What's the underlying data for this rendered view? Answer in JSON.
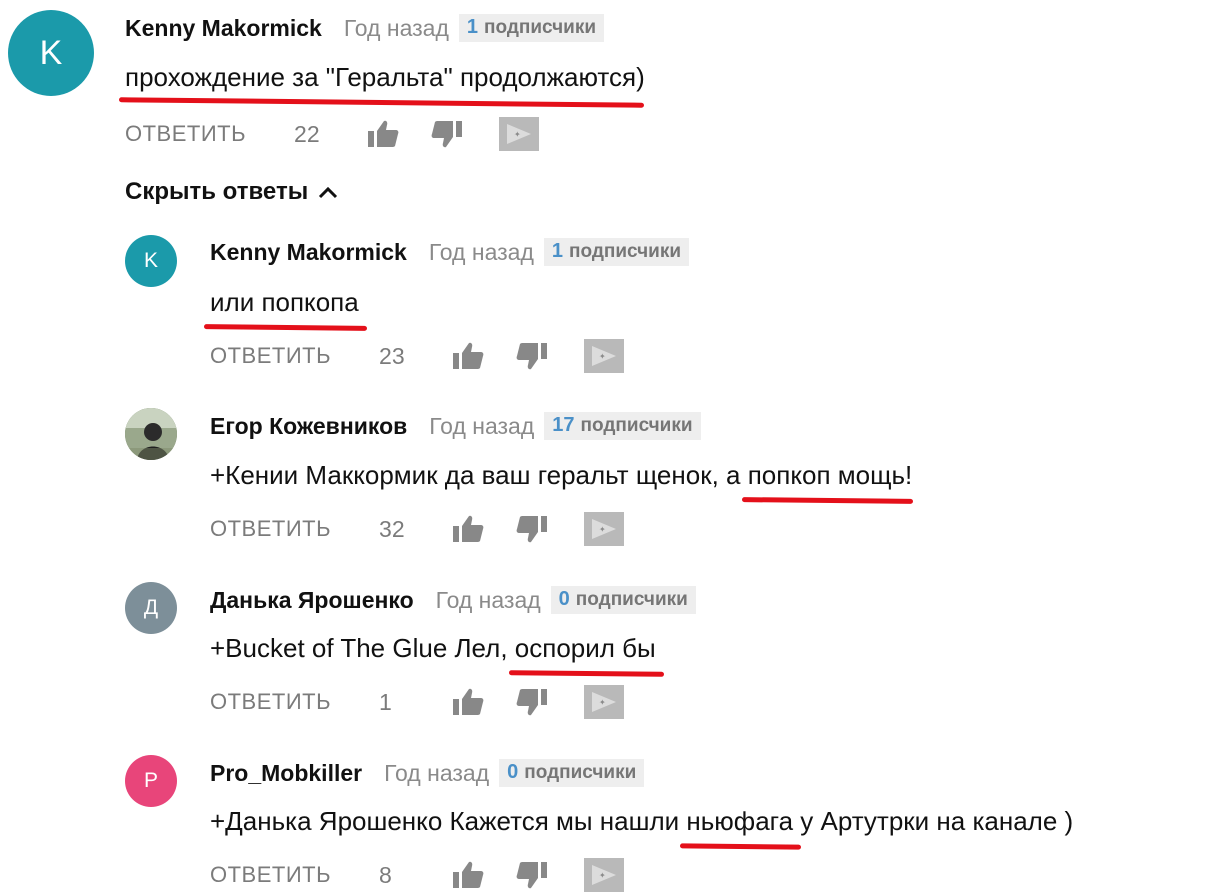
{
  "comments": [
    {
      "author": "Kenny Makormick",
      "time": "Год назад",
      "subs_count": "1",
      "subs_label": "подписчики",
      "avatar_letter": "K",
      "avatar_color": "#1b9aaa",
      "text_pre": "",
      "text_hl": "прохождение за \"Геральта\" продолжаются",
      "text_post": ")",
      "reply": "ОТВЕТИТЬ",
      "likes": "22"
    },
    {
      "author": "Kenny Makormick",
      "time": "Год назад",
      "subs_count": "1",
      "subs_label": "подписчики",
      "avatar_letter": "K",
      "avatar_color": "#1b9aaa",
      "text_pre": "",
      "text_hl": "или попкопа",
      "text_post": "",
      "reply": "ОТВЕТИТЬ",
      "likes": "23"
    },
    {
      "author": "Егор Кожевников",
      "time": "Год назад",
      "subs_count": "17",
      "subs_label": "подписчики",
      "avatar_letter": "",
      "avatar_color": "#6b7a5c",
      "text_pre": "+Кении Маккормик да ваш геральт щенок, а ",
      "text_hl": "попкоп мощь",
      "text_post": "!",
      "reply": "ОТВЕТИТЬ",
      "likes": "32"
    },
    {
      "author": "Данька Ярошенко",
      "time": "Год назад",
      "subs_count": "0",
      "subs_label": "подписчики",
      "avatar_letter": "Д",
      "avatar_color": "#7d8f99",
      "text_pre": "+Bucket of The Glue Лел, ",
      "text_hl": "оспорил бы",
      "text_post": "",
      "reply": "ОТВЕТИТЬ",
      "likes": "1"
    },
    {
      "author": "Pro_Mobkiller",
      "time": "Год назад",
      "subs_count": "0",
      "subs_label": "подписчики",
      "avatar_letter": "P",
      "avatar_color": "#e8457a",
      "text_pre": "+Данька Ярошенко Кажется мы нашли ",
      "text_hl": "ньюфага",
      "text_post": " у Артутрки на канале )",
      "reply": "ОТВЕТИТЬ",
      "likes": "8"
    }
  ],
  "toggle_label": "Скрыть ответы",
  "icons": {
    "like": "thumbs-up-icon",
    "dislike": "thumbs-down-icon",
    "gift": "tip-jar-icon",
    "chevron": "chevron-up-icon"
  },
  "colors": {
    "underline": "#e4101a",
    "subs_count": "#4a90c8"
  }
}
